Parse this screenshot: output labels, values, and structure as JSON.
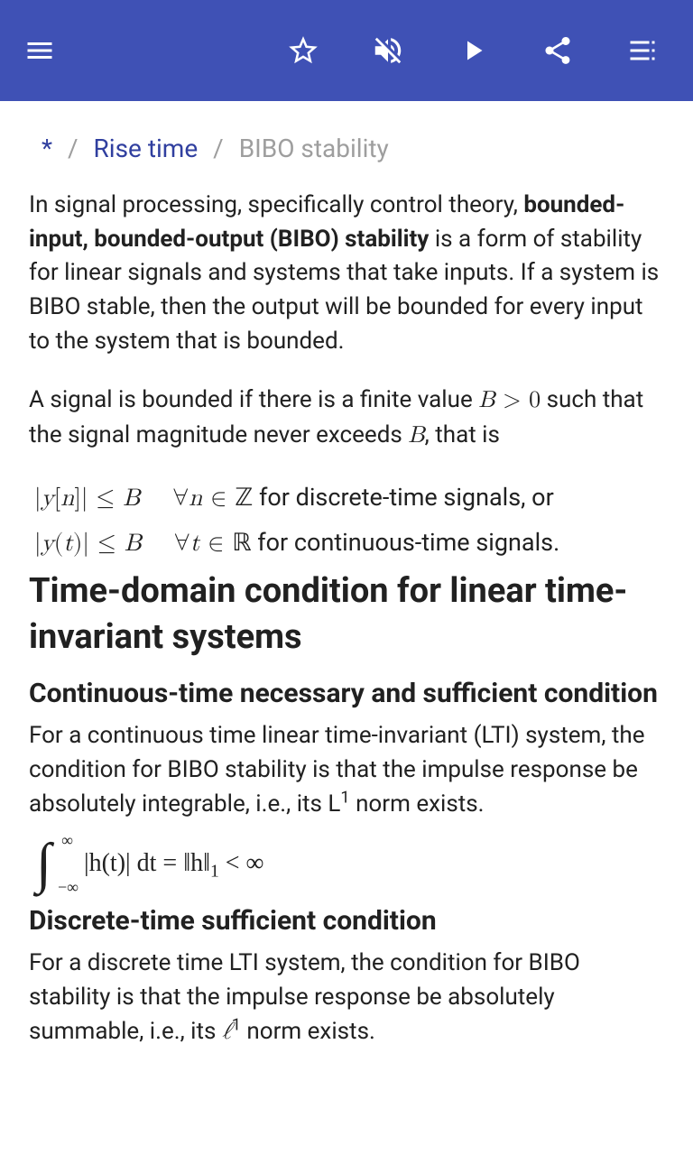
{
  "breadcrumb": {
    "root": "*",
    "link": "Rise time",
    "current": "BIBO stability"
  },
  "intro": {
    "pre": "In signal processing, specifically control theory, ",
    "bold": "bounded-input, bounded-output (BIBO) stability",
    "post": " is a form of stability for linear signals and systems that take inputs. If a system is BIBO stable, then the output will be bounded for every input to the system that is bounded."
  },
  "bounded": {
    "pre": "A signal is bounded if there is a finite value ",
    "m1": "B > 0",
    "mid": " such that the signal magnitude never exceeds ",
    "m2": "B",
    "post": ", that is"
  },
  "eq1": {
    "line1_text": " for discrete-time signals, or",
    "line2_text": " for continuous-time signals."
  },
  "h1": "Time-domain condition for linear time-invariant systems",
  "cont": {
    "h2": "Continuous-time necessary and sufficient condition",
    "p_pre": "For a continuous time linear time-invariant (LTI) system, the condition for BIBO stability is that the impulse response be absolutely integrable, i.e., its L",
    "p_sup": "1",
    "p_post": " norm exists."
  },
  "disc": {
    "h2": "Discrete-time sufficient condition",
    "p_pre": "For a discrete time LTI system, the condition for BIBO stability is that the impulse response be absolutely summable, i.e., its ",
    "p_ell": "ℓ",
    "p_sup": "1",
    "p_post": " norm exists."
  }
}
